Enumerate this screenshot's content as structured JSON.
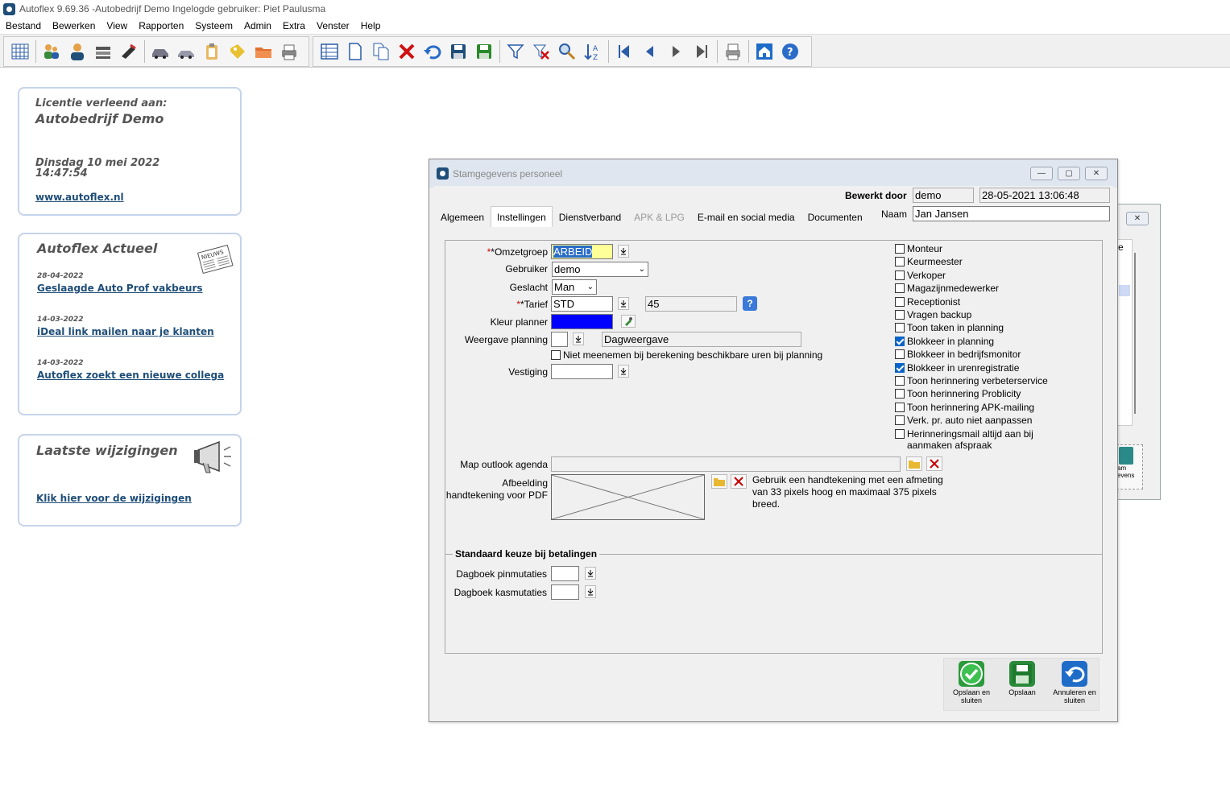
{
  "window": {
    "title": "Autoflex 9.69.36 -Autobedrijf Demo  Ingelogde gebruiker: Piet Paulusma"
  },
  "menu": [
    "Bestand",
    "Bewerken",
    "View",
    "Rapporten",
    "Systeem",
    "Admin",
    "Extra",
    "Venster",
    "Help"
  ],
  "license": {
    "label": "Licentie verleend aan:",
    "company": "Autobedrijf Demo",
    "date": "Dinsdag 10 mei 2022",
    "time": "14:47:54",
    "link": "www.autoflex.nl"
  },
  "news": {
    "title": "Autoflex Actueel",
    "items": [
      {
        "date": "28-04-2022",
        "text": "Geslaagde Auto Prof vakbeurs"
      },
      {
        "date": "14-03-2022",
        "text": "iDeal link mailen naar je klanten"
      },
      {
        "date": "14-03-2022",
        "text": "Autoflex zoekt een nieuwe collega"
      }
    ]
  },
  "changes": {
    "title": "Laatste wijzigingen",
    "link": "Klik hier voor de wijzigingen"
  },
  "dialog": {
    "title": "Stamgegevens personeel",
    "edited_by_label": "Bewerkt door",
    "edited_by": "demo",
    "edited_at": "28-05-2021 13:06:48",
    "tabs": [
      "Algemeen",
      "Instellingen",
      "Dienstverband",
      "APK & LPG",
      "E-mail en social media",
      "Documenten"
    ],
    "naam_label": "Naam",
    "naam": "Jan Jansen",
    "omzetgroep_label": "*Omzetgroep",
    "omzetgroep": "ARBEID",
    "gebruiker_label": "Gebruiker",
    "gebruiker": "demo",
    "geslacht_label": "Geslacht",
    "geslacht": "Man",
    "tarief_label": "*Tarief",
    "tarief": "STD",
    "tarief_value": "45",
    "kleur_label": "Kleur planner",
    "kleur": "#0000ff",
    "weergave_label": "Weergave planning",
    "weergave": "Dagweergave",
    "niet_meenemen": "Niet meenemen bij berekening beschikbare uren bij planning",
    "vestiging_label": "Vestiging",
    "map_outlook_label": "Map outlook agenda",
    "afbeelding_label": "Afbeelding handtekening voor PDF",
    "afbeelding_hint": "Gebruik een handtekening met een afmeting van 33 pixels hoog en maximaal 375 pixels breed.",
    "betalingen_title": "Standaard keuze bij betalingen",
    "pin_label": "Dagboek pinmutaties",
    "kas_label": "Dagboek kasmutaties",
    "checks": [
      {
        "label": "Monteur",
        "checked": false
      },
      {
        "label": "Keurmeester",
        "checked": false
      },
      {
        "label": "Verkoper",
        "checked": false
      },
      {
        "label": "Magazijnmedewerker",
        "checked": false
      },
      {
        "label": "Receptionist",
        "checked": false
      },
      {
        "label": "Vragen backup",
        "checked": false
      },
      {
        "label": "Toon taken in planning",
        "checked": false
      },
      {
        "label": "Blokkeer in planning",
        "checked": true
      },
      {
        "label": "Blokkeer in bedrijfsmonitor",
        "checked": false
      },
      {
        "label": "Blokkeer in urenregistratie",
        "checked": true
      },
      {
        "label": "Toon herinnering verbeterservice",
        "checked": false
      },
      {
        "label": "Toon herinnering Problicity",
        "checked": false
      },
      {
        "label": "Toon herinnering APK-mailing",
        "checked": false
      },
      {
        "label": "Verk. pr. auto niet aanpassen",
        "checked": false
      },
      {
        "label": "Herinneringsmail altijd aan bij aanmaken afspraak",
        "checked": false
      }
    ],
    "buttons": {
      "save_close": "Opslaan en sluiten",
      "save": "Opslaan",
      "cancel_close": "Annuleren en sluiten"
    }
  },
  "back_window": {
    "text1": "e",
    "text2": "am",
    "text3": "evens"
  }
}
